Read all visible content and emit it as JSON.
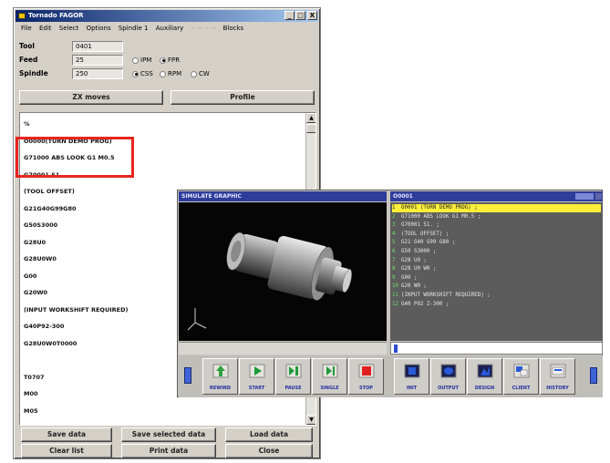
{
  "window": {
    "title": "Tornado FAGOR",
    "controls": [
      "_",
      "□",
      "X"
    ]
  },
  "menu": [
    {
      "label": "File",
      "disabled": false
    },
    {
      "label": "Edit",
      "disabled": false
    },
    {
      "label": "Select",
      "disabled": false
    },
    {
      "label": "Options",
      "disabled": false
    },
    {
      "label": "Spindle 1",
      "disabled": false
    },
    {
      "label": "Auxiliary",
      "disabled": false
    },
    {
      "label": "-- -- -- --",
      "disabled": true
    },
    {
      "label": "Blocks",
      "disabled": false
    }
  ],
  "fields": {
    "tool": {
      "label": "Tool",
      "value": "0401"
    },
    "feed": {
      "label": "Feed",
      "value": "25"
    },
    "spindle": {
      "label": "Spindle",
      "value": "250"
    }
  },
  "feed_mode": [
    {
      "label": "IPM",
      "selected": false
    },
    {
      "label": "FPR",
      "selected": true
    }
  ],
  "spindle_mode": [
    {
      "label": "CSS",
      "selected": true
    },
    {
      "label": "RPM",
      "selected": false
    },
    {
      "label": "CW",
      "selected": false
    }
  ],
  "buttons": {
    "zx_moves": "ZX moves",
    "profile": "Profile",
    "save_data": "Save data",
    "save_selected": "Save selected data",
    "load_data": "Load data",
    "clear_list": "Clear list",
    "print_data": "Print data",
    "close": "Close"
  },
  "program_list": [
    "%",
    "O0000(TURN DEMO PROG)",
    "G71000 ABS LOOK G1 M0.5",
    "G70001 S1",
    "(TOOL OFFSET)",
    "G21G40G99G80",
    "G50S3000",
    "G28U0",
    "G28U0W0",
    "G00",
    "G20W0",
    "(INPUT WORKSHIFT REQUIRED)",
    "G40P92-300",
    "G28U0W0T0000",
    "",
    "T0707",
    "M00",
    "M05"
  ],
  "simulator": {
    "title": "SIMULATE GRAPHIC",
    "program_title": "O0001",
    "program_badge": "",
    "program_lines": [
      {
        "n": "1",
        "text": "O0001 (TURN DEMO PROG) ;",
        "selected": true
      },
      {
        "n": "2",
        "text": "G71000 ABS LOOK G1 M0.5 ;",
        "selected": false
      },
      {
        "n": "3",
        "text": "G70001 S1. ;",
        "selected": false
      },
      {
        "n": "4",
        "text": "(TOOL OFFSET) ;",
        "selected": false
      },
      {
        "n": "5",
        "text": "G21 G40 G99 G80 ;",
        "selected": false
      },
      {
        "n": "6",
        "text": "G50 S3000 ;",
        "selected": false
      },
      {
        "n": "7",
        "text": "G28 U0 ;",
        "selected": false
      },
      {
        "n": "8",
        "text": "G28 U0 W0 ;",
        "selected": false
      },
      {
        "n": "9",
        "text": "G00 ;",
        "selected": false
      },
      {
        "n": "10",
        "text": "G20 W0 ;",
        "selected": false
      },
      {
        "n": "11",
        "text": "(INPUT WORKSHIFT REQUIRED) ;",
        "selected": false
      },
      {
        "n": "12",
        "text": "G40 P92 Z-300 ;",
        "selected": false
      }
    ],
    "toolbar": [
      {
        "label": "REWIND",
        "icon": "rewind-icon",
        "color": "#30a040"
      },
      {
        "label": "START",
        "icon": "play-icon",
        "color": "#1e9a3a"
      },
      {
        "label": "PAUSE",
        "icon": "step-icon",
        "color": "#1e9a3a"
      },
      {
        "label": "SINGLE",
        "icon": "single-step-icon",
        "color": "#1e9a3a"
      },
      {
        "label": "STOP",
        "icon": "stop-icon",
        "color": "#e02020"
      },
      {
        "label": "INIT",
        "icon": "init-icon",
        "color": "#2a5ad8"
      },
      {
        "label": "OUTPUT",
        "icon": "output-icon",
        "color": "#2a5ad8"
      },
      {
        "label": "DESIGN",
        "icon": "design-icon",
        "color": "#2a5ad8"
      },
      {
        "label": "CLIENT",
        "icon": "client-icon",
        "color": "#2a5ad8"
      },
      {
        "label": "HISTORY",
        "icon": "history-icon",
        "color": "#2a5ad8"
      }
    ]
  },
  "colors": {
    "highlight": "#e8251f",
    "panel_title": "#2f3d9a",
    "selected_line": "#ffef3a"
  }
}
